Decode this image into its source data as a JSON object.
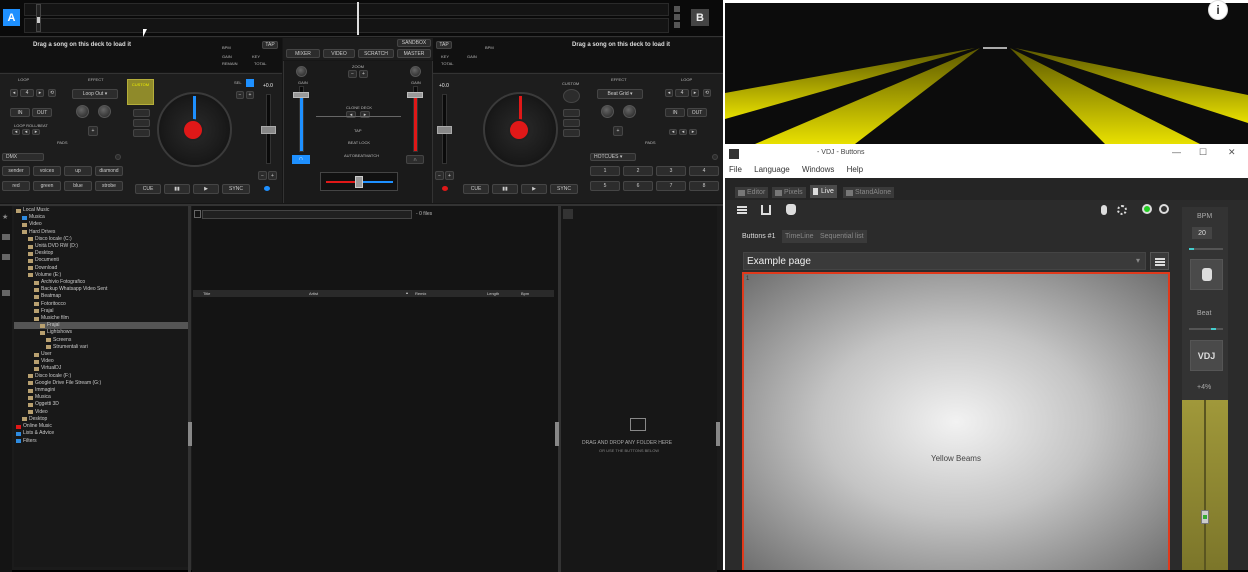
{
  "deck_a": {
    "letter": "A",
    "drop_text": "Drag a song on this deck to load it",
    "bpm_label": "BPM",
    "tap": "TAP",
    "gain": "GAIN",
    "key": "KEY",
    "remain": "REMAIN",
    "total": "TOTAL",
    "loop": "LOOP",
    "effect": "EFFECT",
    "effect_value": "Loop Out",
    "loop_value": "4",
    "in": "IN",
    "out": "OUT",
    "loop_roll": "LOOP ROLL/BEAT",
    "custom": "CUSTOM",
    "pads": "PADS",
    "pad_mode": "DMX",
    "pads_row1": [
      "sender",
      "voices",
      "up",
      "diamond"
    ],
    "pads_row2": [
      "red",
      "green",
      "blue",
      "strobe"
    ],
    "cue": "CUE",
    "sync": "SYNC",
    "pitch": "+0.0"
  },
  "deck_b": {
    "letter": "B",
    "drop_text": "Drag a song on this deck to load it",
    "custom": "CUSTOM",
    "effect": "EFFECT",
    "effect_value": "Beat Grid",
    "loop": "LOOP",
    "pads": "PADS",
    "pad_mode": "HOTCUES",
    "pads_row1": [
      "1",
      "2",
      "3",
      "4"
    ],
    "pads_row2": [
      "5",
      "6",
      "7",
      "8"
    ],
    "cue": "CUE",
    "sync": "SYNC",
    "pitch": "+0.0"
  },
  "mixer": {
    "tabs": [
      "MIXER",
      "VIDEO",
      "SCRATCH",
      "SANDBOX",
      "MASTER"
    ],
    "zoom": "ZOOM",
    "gain": "GAIN",
    "clone_deck": "CLONE DECK",
    "tap": "TAP",
    "beat_lock": "BEAT LOCK",
    "auto_beatmatch": "AUTOBEATMATCH"
  },
  "browser": {
    "folders": [
      {
        "label": "Local Music",
        "indent": 0
      },
      {
        "label": "Musica",
        "indent": 1
      },
      {
        "label": "Video",
        "indent": 1
      },
      {
        "label": "Hard Drives",
        "indent": 1
      },
      {
        "label": "Disco locale (C:)",
        "indent": 2
      },
      {
        "label": "Unità DVD RW (D:)",
        "indent": 2
      },
      {
        "label": "Desktop",
        "indent": 2
      },
      {
        "label": "Documenti",
        "indent": 2
      },
      {
        "label": "Download",
        "indent": 2
      },
      {
        "label": "Volume (E:)",
        "indent": 2
      },
      {
        "label": "Archivio Fotografico",
        "indent": 3
      },
      {
        "label": "Backup Whatsapp Video Sent",
        "indent": 3
      },
      {
        "label": "Beatmap",
        "indent": 3
      },
      {
        "label": "Fotoritocco",
        "indent": 3
      },
      {
        "label": "Frajal",
        "indent": 3
      },
      {
        "label": "Musiche film",
        "indent": 3
      },
      {
        "label": "Frajal",
        "indent": 4
      },
      {
        "label": "Lightshows",
        "indent": 4
      },
      {
        "label": "Screens",
        "indent": 5
      },
      {
        "label": "Strumentali vari",
        "indent": 5
      },
      {
        "label": "User",
        "indent": 3
      },
      {
        "label": "Video",
        "indent": 3
      },
      {
        "label": "VirtualDJ",
        "indent": 3
      },
      {
        "label": "Disco locale (F:)",
        "indent": 2
      },
      {
        "label": "Google Drive File Stream (G:)",
        "indent": 2
      },
      {
        "label": "Immagini",
        "indent": 2
      },
      {
        "label": "Musica",
        "indent": 2
      },
      {
        "label": "Oggetti 3D",
        "indent": 2
      },
      {
        "label": "Video",
        "indent": 2
      },
      {
        "label": "Desktop",
        "indent": 1
      },
      {
        "label": "Online Music",
        "indent": 0
      },
      {
        "label": "Lists & Advice",
        "indent": 0
      },
      {
        "label": "Filters",
        "indent": 0
      }
    ],
    "file_count": "0 files",
    "columns": [
      "Title",
      "Artist",
      "Remix",
      "Length",
      "Bpm"
    ],
    "drop_line1": "DRAG AND DROP ANY FOLDER HERE",
    "drop_line2": "OR USE THE BUTTONS BELOW"
  },
  "vdj": {
    "title": "- VDJ - Buttons",
    "menu": [
      "File",
      "Language",
      "Windows",
      "Help"
    ],
    "tabs": [
      "Editor",
      "Pixels",
      "Live",
      "StandAlone"
    ],
    "subtabs": [
      "Buttons #1",
      "TimeLine",
      "Sequential list"
    ],
    "page_name": "Example page",
    "corner_label": "1",
    "button_label": "Yellow Beams",
    "bpm_label": "BPM",
    "bpm_value": "20",
    "beat_label": "Beat",
    "vdj_button": "VDJ",
    "percent": "+4%",
    "min": "—",
    "max": "☐",
    "close": "✕"
  },
  "info": "i",
  "colors": {
    "accent_blue": "#1e90ff",
    "red": "#e01818",
    "yellow": "#e8e000",
    "olive": "#8f8a2a",
    "vdj_red": "#e0391b"
  }
}
